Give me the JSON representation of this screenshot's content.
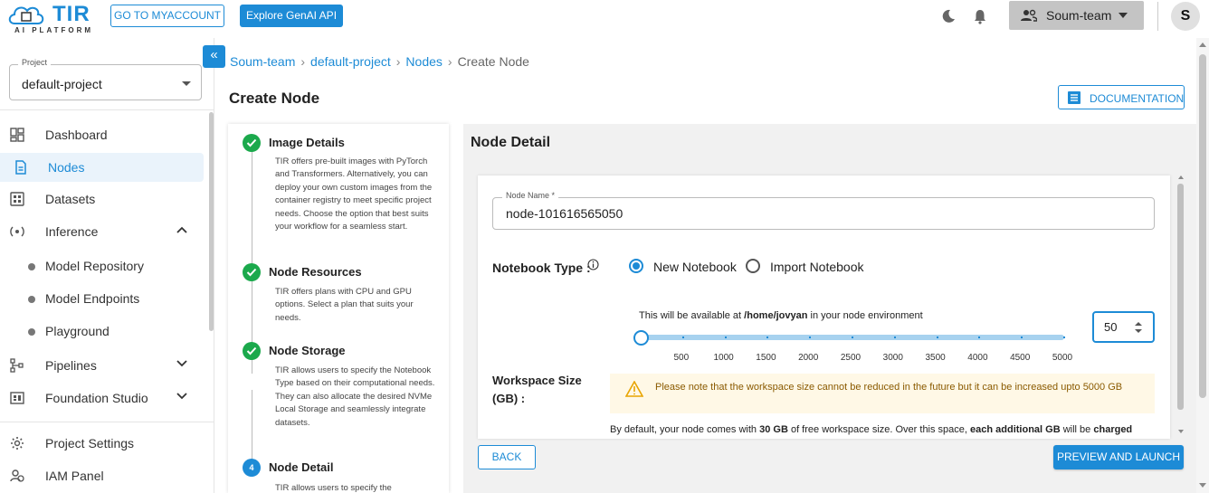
{
  "header": {
    "logo_text": "TIR",
    "logo_sub": "AI PLATFORM",
    "myaccount_label": "GO TO MYACCOUNT",
    "genai_label": "Explore GenAI API",
    "team_label": "Soum-team",
    "avatar_initial": "S"
  },
  "sidebar": {
    "project_legend": "Project",
    "project_value": "default-project",
    "items": [
      {
        "label": "Dashboard"
      },
      {
        "label": "Nodes"
      },
      {
        "label": "Datasets"
      },
      {
        "label": "Inference"
      },
      {
        "label": "Model Repository"
      },
      {
        "label": "Model Endpoints"
      },
      {
        "label": "Playground"
      },
      {
        "label": "Pipelines"
      },
      {
        "label": "Foundation Studio"
      },
      {
        "label": "Project Settings"
      },
      {
        "label": "IAM Panel"
      }
    ],
    "collapse_glyph": "«"
  },
  "breadcrumb": {
    "items": [
      "Soum-team",
      "default-project",
      "Nodes"
    ],
    "current": "Create Node",
    "separator": "›"
  },
  "page": {
    "title": "Create Node",
    "doc_label": "DOCUMENTATION"
  },
  "steps": [
    {
      "title": "Image Details",
      "desc": "TIR offers pre-built images with PyTorch and Transformers. Alternatively, you can deploy your own custom images from the container registry to meet specific project needs. Choose the option that best suits your workflow for a seamless start."
    },
    {
      "title": "Node Resources",
      "desc": "TIR offers plans with CPU and GPU options. Select a plan that suits your needs."
    },
    {
      "title": "Node Storage",
      "desc": "TIR allows users to specify the Notebook Type based on their computational needs. They can also allocate the desired NVMe Local Storage and seamlessly integrate datasets."
    },
    {
      "title": "Node Detail",
      "number": "4",
      "desc": "TIR allows users to specify the"
    }
  ],
  "detail": {
    "title": "Node Detail",
    "name_legend": "Node Name *",
    "name_value": "node-101616565050",
    "notebook_type_label": "Notebook Type :",
    "radio_new": "New Notebook",
    "radio_import": "Import Notebook",
    "avail_prefix": "This will be available at ",
    "avail_path": "/home/jovyan",
    "avail_suffix": " in your node environment",
    "slider_ticks": [
      "500",
      "1000",
      "1500",
      "2000",
      "2500",
      "3000",
      "3500",
      "4000",
      "4500",
      "5000"
    ],
    "workspace_value": "50",
    "workspace_level": 50,
    "workspace_max": 5000,
    "workspace_label": "Workspace Size (GB) :",
    "warning": "Please note that the workspace size cannot be reduced in the future but it can be increased upto 5000 GB",
    "note_1": "By default, your node comes with ",
    "note_2": "30 GB",
    "note_3": " of free workspace size. Over this space, ",
    "note_4": "each additional GB",
    "note_5": " will be ",
    "note_6": "charged",
    "back_label": "BACK",
    "launch_label": "PREVIEW AND LAUNCH"
  },
  "colors": {
    "accent": "#1d8bd6",
    "success": "#1ba94c",
    "warning_bg": "#fff8e6"
  }
}
